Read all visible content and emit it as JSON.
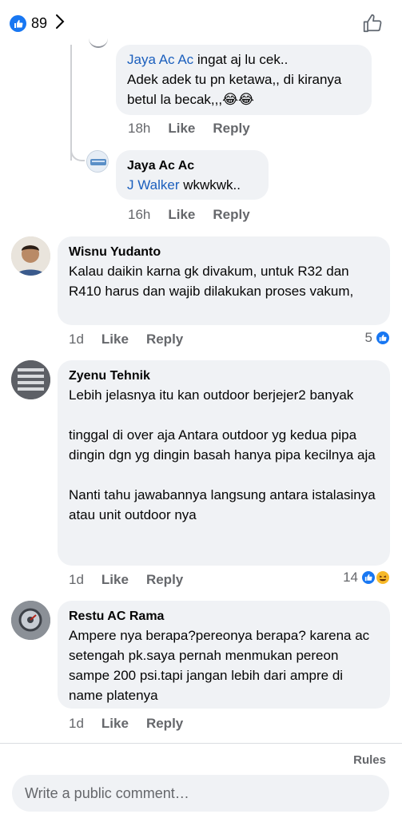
{
  "header": {
    "like_count": "89"
  },
  "comments": [
    {
      "mention": "Jaya Ac Ac",
      "text_first": " ingat aj lu cek..",
      "text_rest": "Adek adek tu pn ketawa,, di kiranya betul la becak,,,😂😂",
      "time": "18h",
      "like": "Like",
      "reply": "Reply"
    },
    {
      "author": "Jaya Ac Ac",
      "mention": "J Walker",
      "text": " wkwkwk..",
      "time": "16h",
      "like": "Like",
      "reply": "Reply"
    },
    {
      "author": "Wisnu Yudanto",
      "text": "Kalau daikin karna gk divakum, untuk R32 dan R410 harus dan wajib dilakukan proses vakum,",
      "time": "1d",
      "like": "Like",
      "reply": "Reply",
      "reaction_count": "5"
    },
    {
      "author": "Zyenu Tehnik",
      "text": "Lebih jelasnya itu kan outdoor berjejer2 banyak\n\ntinggal di over aja Antara outdoor yg kedua pipa dingin dgn yg dingin basah hanya pipa kecilnya aja\n\nNanti tahu jawabannya langsung antara istalasinya atau unit outdoor nya",
      "time": "1d",
      "like": "Like",
      "reply": "Reply",
      "reaction_count": "14"
    },
    {
      "author": "Restu AC Rama",
      "text": "Ampere nya berapa?pereonya berapa? karena ac setengah pk.saya pernah menmukan pereon sampe 200 psi.tapi jangan lebih dari ampre di name platenya",
      "time": "1d",
      "like": "Like",
      "reply": "Reply"
    }
  ],
  "footer": {
    "rules": "Rules",
    "placeholder": "Write a public comment…"
  },
  "colors": {
    "accent": "#1877f2",
    "mention": "#1b5fbd",
    "bubble": "#f0f2f5",
    "muted": "#65676b"
  }
}
